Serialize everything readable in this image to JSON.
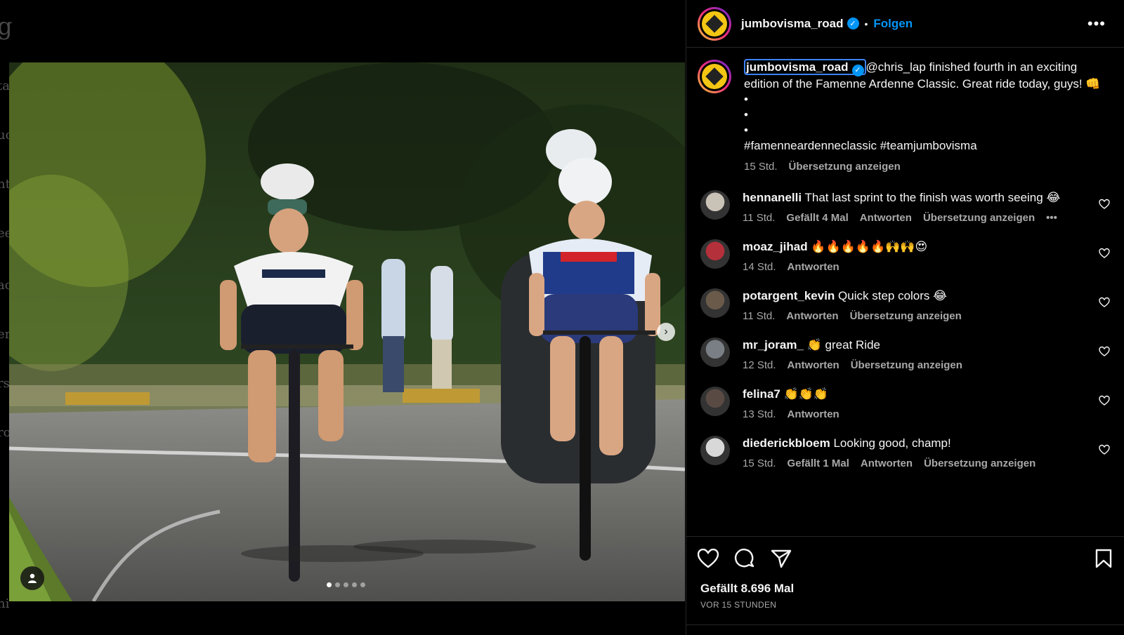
{
  "post": {
    "username": "jumbovisma_road",
    "follow_label": "Folgen",
    "more_icon": "more-horizontal-icon",
    "image_slide_count": 5,
    "image_active_slide": 1
  },
  "caption": {
    "username": "jumbovisma_road",
    "text": "@chris_lap finished fourth in an exciting edition of the Famenne Ardenne Classic. Great ride today, guys! 👊",
    "bullets": [
      "•",
      "•",
      "•"
    ],
    "hashtags": "#famenneardenneclassic #teamjumbovisma",
    "time": "15 Std.",
    "translate_label": "Übersetzung anzeigen"
  },
  "comments": [
    {
      "user": "hennanelli",
      "text": "That last sprint to the finish was worth seeing 😂",
      "time": "11 Std.",
      "likes": "Gefällt 4 Mal",
      "reply": "Antworten",
      "translate": "Übersetzung anzeigen",
      "more": "•••",
      "avatar_color": "#c9c2b6"
    },
    {
      "user": "moaz_jihad",
      "text": "🔥🔥🔥🔥🔥🙌🙌😍",
      "time": "14 Std.",
      "likes": "",
      "reply": "Antworten",
      "translate": "",
      "more": "",
      "avatar_color": "#b4303a"
    },
    {
      "user": "potargent_kevin",
      "text": "Quick step colors 😂",
      "time": "11 Std.",
      "likes": "",
      "reply": "Antworten",
      "translate": "Übersetzung anzeigen",
      "more": "",
      "avatar_color": "#6a5a4a"
    },
    {
      "user": "mr_joram_",
      "text": "👏 great Ride",
      "time": "12 Std.",
      "likes": "",
      "reply": "Antworten",
      "translate": "Übersetzung anzeigen",
      "more": "",
      "avatar_color": "#7a7f86"
    },
    {
      "user": "felina7",
      "text": "👏👏👏",
      "time": "13 Std.",
      "likes": "",
      "reply": "Antworten",
      "translate": "",
      "more": "",
      "avatar_color": "#5a4a44"
    },
    {
      "user": "diederickbloem",
      "text": "Looking good, champ!",
      "time": "15 Std.",
      "likes": "Gefällt 1 Mal",
      "reply": "Antworten",
      "translate": "Übersetzung anzeigen",
      "more": "",
      "avatar_color": "#d8d8d8"
    }
  ],
  "footer": {
    "likes_text": "Gefällt 8.696 Mal",
    "time_ago": "VOR 15 STUNDEN"
  },
  "edge_letters": [
    "g",
    "ta",
    "uc",
    "nt",
    "ee",
    "ac",
    "er",
    "rs",
    "ro",
    "hi"
  ],
  "colors": {
    "accent": "#0095f6",
    "secondary_text": "#a8a8a8",
    "background": "#000000"
  }
}
